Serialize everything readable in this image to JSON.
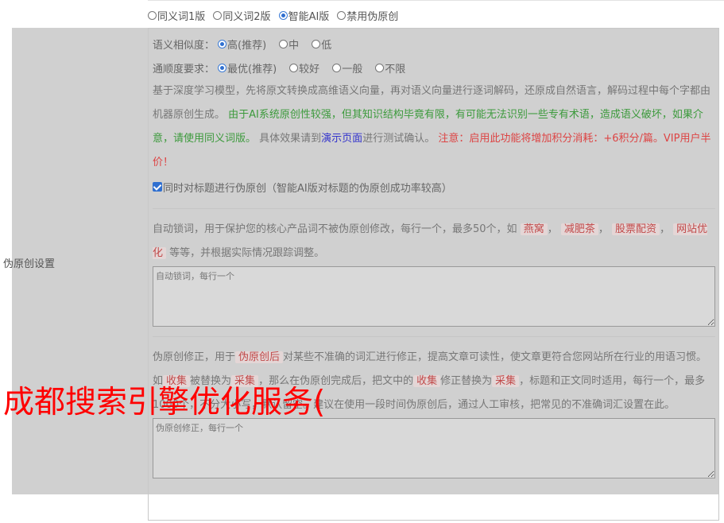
{
  "versions": [
    {
      "label": "同义词1版",
      "selected": false
    },
    {
      "label": "同义词2版",
      "selected": false
    },
    {
      "label": "智能AI版",
      "selected": true
    },
    {
      "label": "禁用伪原创",
      "selected": false
    }
  ],
  "side_label": "伪原创设置",
  "similarity": {
    "label": "语义相似度：",
    "options": [
      {
        "label": "高(推荐)",
        "selected": true
      },
      {
        "label": "中",
        "selected": false
      },
      {
        "label": "低",
        "selected": false
      }
    ]
  },
  "fluency": {
    "label": "通顺度要求：",
    "options": [
      {
        "label": "最优(推荐)",
        "selected": true
      },
      {
        "label": "较好",
        "selected": false
      },
      {
        "label": "一般",
        "selected": false
      },
      {
        "label": "不限",
        "selected": false
      }
    ]
  },
  "description": {
    "p1": "基于深度学习模型，先将原文转换成高维语义向量，再对语义向量进行逐词解码，还原成自然语言，解码过程中每个字都由机器原创生成。",
    "green": "由于AI系统原创性较强，但其知识结构毕竟有限，有可能无法识别一些专有术语，造成语义破坏，如果介意，请使用同义词版。",
    "p2": "具体效果请到",
    "link": "演示页面",
    "p3": "进行测试确认。",
    "red": "注意：启用此功能将增加积分消耗：+6积分/篇。VIP用户半价！"
  },
  "title_checkbox": {
    "label": "同时对标题进行伪原创（智能AI版对标题的伪原创成功率较高）",
    "checked": true
  },
  "lock_words": {
    "text1": "自动锁词，用于保护您的核心产品词不被伪原创修改，每行一个，最多50个，如",
    "tags": [
      "燕窝",
      "减肥茶",
      "股票配资",
      "网站优化"
    ],
    "text2": "等等，并根据实际情况跟踪调整。",
    "placeholder": "自动锁词，每行一个"
  },
  "correction": {
    "t1": "伪原创修正，用于",
    "tag1": "伪原创后",
    "t2": "对某些不准确的词汇进行修正，提高文章可读性，使文章更符合您网站所在行业的用语习惯。如",
    "tag2": "收集",
    "t3": "被替换为",
    "tag3": "采集",
    "t4": "，那么在伪原创完成后，把文中的",
    "tag4": "收集",
    "t5": "修正替换为",
    "tag5": "采集",
    "t6": "，标题和正文同时适用，每行一个，最多1000个，不分大小写，默认留空。建议在使用一段时间伪原创后，通过人工审核，把常见的不准确词汇设置在此。",
    "placeholder": "伪原创修正，每行一个"
  },
  "watermark": "成都搜索引擎优化服务("
}
